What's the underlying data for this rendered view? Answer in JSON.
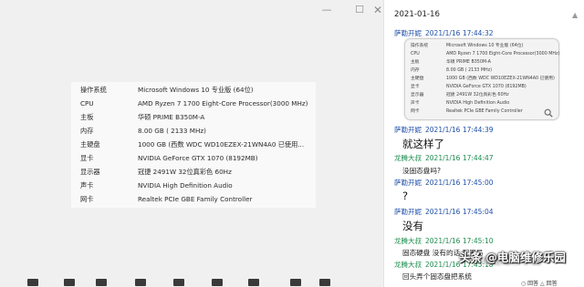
{
  "window": {
    "minimize": "—",
    "maximize": "☐",
    "close": "✕"
  },
  "info_panel": {
    "rows": [
      {
        "key": "操作系统",
        "value": "Microsoft Windows 10 专业版 (64位)"
      },
      {
        "key": "CPU",
        "value": "AMD Ryzen 7 1700 Eight-Core Processor(3000 MHz)"
      },
      {
        "key": "主板",
        "value": "华硕 PRIME B350M-A"
      },
      {
        "key": "内存",
        "value": "8.00 GB ( 2133 MHz)"
      },
      {
        "key": "主硬盘",
        "value": "1000 GB (西数 WDC WD10EZEX-21WN4A0 已使用..."
      },
      {
        "key": "显卡",
        "value": "NVIDIA GeForce GTX 1070 (8192MB)"
      },
      {
        "key": "显示器",
        "value": "冠捷 2491W 32位真彩色 60Hz"
      },
      {
        "key": "声卡",
        "value": "NVIDIA High Definition Audio"
      },
      {
        "key": "网卡",
        "value": "Realtek PCIe GBE Family Controller"
      }
    ]
  },
  "chat": {
    "date": "2021-01-16",
    "messages": [
      {
        "sender": "萨勒开妮",
        "time": "2021/1/16 17:44:32",
        "text": ""
      },
      {
        "sender": "萨勒开妮",
        "time": "2021/1/16 17:44:39",
        "text": "就这样了"
      },
      {
        "sender": "龙腾大叔",
        "time": "2021/1/16 17:44:47",
        "text": "没固态盘吗?"
      },
      {
        "sender": "萨勒开妮",
        "time": "2021/1/16 17:45:00",
        "text": "?"
      },
      {
        "sender": "萨勒开妮",
        "time": "2021/1/16 17:45:04",
        "text": "没有"
      },
      {
        "sender": "龙腾大叔",
        "time": "2021/1/16 17:45:10",
        "text": "固态硬盘 没有的话 配置局"
      },
      {
        "sender": "龙腾大叔",
        "time": "2021/1/16 17:45:18",
        "text": "回头弄个固态盘把系统"
      }
    ],
    "thumbnail_rows": [
      {
        "key": "操作系统",
        "value": "Microsoft Windows 10 专业版 (64位)"
      },
      {
        "key": "CPU",
        "value": "AMD Ryzen 7 1700 Eight-Core Processor(3000 MHz)"
      },
      {
        "key": "主板",
        "value": "华硕 PRIME B350M-A"
      },
      {
        "key": "内存",
        "value": "8.00 GB ( 2133 MHz)"
      },
      {
        "key": "主硬盘",
        "value": "1000 GB (西数 WDC WD10EZEX-21WN4A0 已使用)"
      },
      {
        "key": "显卡",
        "value": "NVIDIA GeForce GTX 1070 (8192MB)"
      },
      {
        "key": "显示器",
        "value": "冠捷 2491W 32位真彩色 60Hz"
      },
      {
        "key": "声卡",
        "value": "NVIDIA High Definition Audio"
      },
      {
        "key": "网卡",
        "value": "Realtek PCIe GBE Family Controller"
      }
    ],
    "footer": "○ 回答    △ 回答",
    "scroll_glyph": "▲"
  },
  "watermark": "头条 @电脑维修乐园",
  "watermark_faded": "电脑维修乐园",
  "icons": [
    "minimize-icon",
    "maximize-icon",
    "close-icon",
    "zoom-icon",
    "scroll-up-icon"
  ],
  "colors": {
    "sender_blue": "#1f4fa8",
    "sender_green": "#1e8c4e",
    "window_bg": "#f0f0f0"
  }
}
